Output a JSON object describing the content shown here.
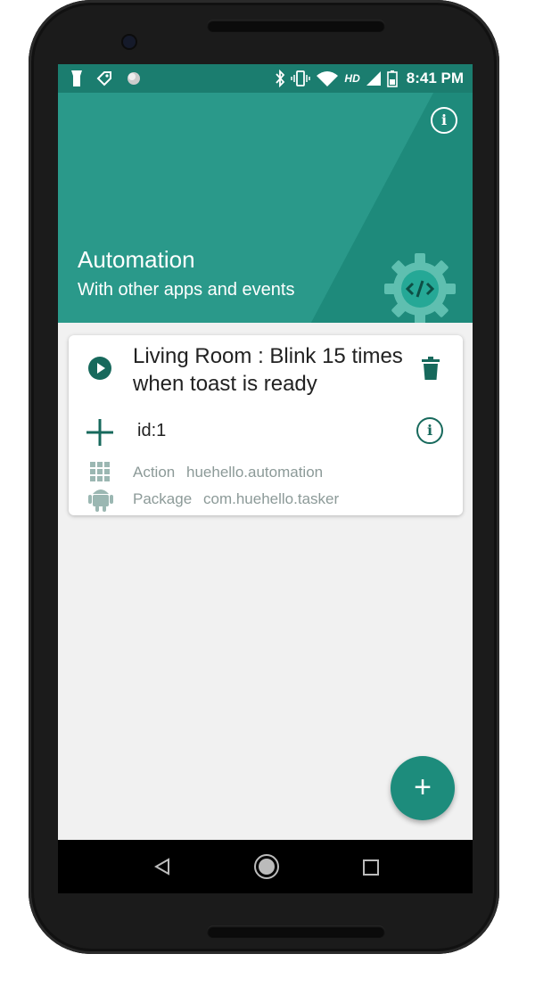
{
  "status_bar": {
    "time": "8:41 PM",
    "network_label": "HD"
  },
  "header": {
    "title": "Automation",
    "subtitle": "With other apps and events"
  },
  "card": {
    "title": "Living Room : Blink 15 times when toast is ready",
    "id_text": "id:1",
    "action_label": "Action",
    "action_value": "huehello.automation",
    "package_label": "Package",
    "package_value": "com.huehello.tasker"
  },
  "fab": {
    "label": "+"
  },
  "colors": {
    "primary": "#1e8a7b",
    "primary_dark": "#17695c",
    "accent": "#1d8c7c",
    "background": "#f1f1f1"
  },
  "icons": {
    "header_info": "info-icon",
    "play": "play-icon",
    "delete": "trash-icon",
    "add": "plus-icon",
    "card_info": "info-icon",
    "action": "grid-icon",
    "package": "android-icon",
    "logo": "gear-code-icon"
  }
}
